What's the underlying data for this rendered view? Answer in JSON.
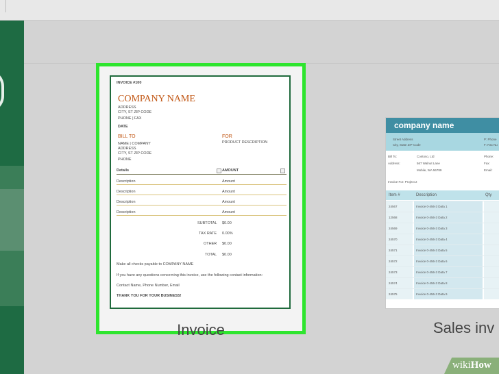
{
  "templates": [
    {
      "title": "Invoice",
      "invoice_no": "INVOICE #100",
      "company_name": "COMPANY NAME",
      "address": "ADDRESS",
      "city": "CITY, ST ZIP CODE",
      "phone_fax": "PHONE | FAX",
      "date": "DATE",
      "bill_to": "BILL TO",
      "bill_name": "NAME | COMPANY",
      "bill_address": "ADDRESS",
      "bill_city": "CITY, ST ZIP CODE",
      "bill_phone": "PHONE",
      "for_label": "FOR",
      "product_desc": "PRODUCT DESCRIPTION",
      "details_header": "Details",
      "amount_header": "AMOUNT",
      "line_items": [
        {
          "description": "Description",
          "amount": "Amount"
        },
        {
          "description": "Description",
          "amount": "Amount"
        },
        {
          "description": "Description",
          "amount": "Amount"
        },
        {
          "description": "Description",
          "amount": "Amount"
        }
      ],
      "totals": [
        {
          "label": "SUBTOTAL",
          "value": "$0.00"
        },
        {
          "label": "TAX RATE",
          "value": "0.00%"
        },
        {
          "label": "OTHER",
          "value": "$0.00"
        },
        {
          "label": "TOTAL",
          "value": "$0.00"
        }
      ],
      "checks_note": "Make all checks payable to COMPANY NAME",
      "questions_note": "If you have any questions concerning this invoice, use the following contact information:",
      "contact_line": "Contact Name, Phone Number, Email",
      "thanks": "THANK YOU FOR YOUR BUSINESS!"
    },
    {
      "title": "Sales inv",
      "company_name": "company name",
      "street": "Street Address",
      "city_state": "City, State ZIP Code",
      "phone": "P: Phone",
      "fax": "F: Fax Nu",
      "bill_to_label": "Bill To:",
      "bill_to_value": "Contoso, Ltd",
      "address_label": "Address:",
      "address_value": "567 Walnut Lane",
      "city_value": "Mobile, WA 56789",
      "phone_label": "Phone:",
      "fax_label": "Fax:",
      "email_label": "Email:",
      "invoice_for": "Invoice For: Project 2",
      "columns": [
        "Item #",
        "Description",
        "Qty"
      ],
      "rows": [
        {
          "item": "24567",
          "description": "Invoice 0-456-3 Data 1"
        },
        {
          "item": "12568",
          "description": "Invoice 0-456-3 Data 2"
        },
        {
          "item": "24569",
          "description": "Invoice 0-456-3 Data 3"
        },
        {
          "item": "24570",
          "description": "Invoice 0-456-3 Data 4"
        },
        {
          "item": "24571",
          "description": "Invoice 0-456-3 Data 5"
        },
        {
          "item": "24572",
          "description": "Invoice 0-456-3 Data 6"
        },
        {
          "item": "24573",
          "description": "Invoice 0-456-3 Data 7"
        },
        {
          "item": "24574",
          "description": "Invoice 0-456-3 Data 8"
        },
        {
          "item": "24575",
          "description": "Invoice 0-456-3 Data 9"
        }
      ]
    }
  ],
  "watermark": {
    "prefix": "wiki",
    "suffix": "How"
  },
  "colors": {
    "selection": "#2ee52e",
    "excel_green": "#1e6b43",
    "invoice_accent": "#c0530f",
    "sales_header": "#3f8ea3"
  }
}
